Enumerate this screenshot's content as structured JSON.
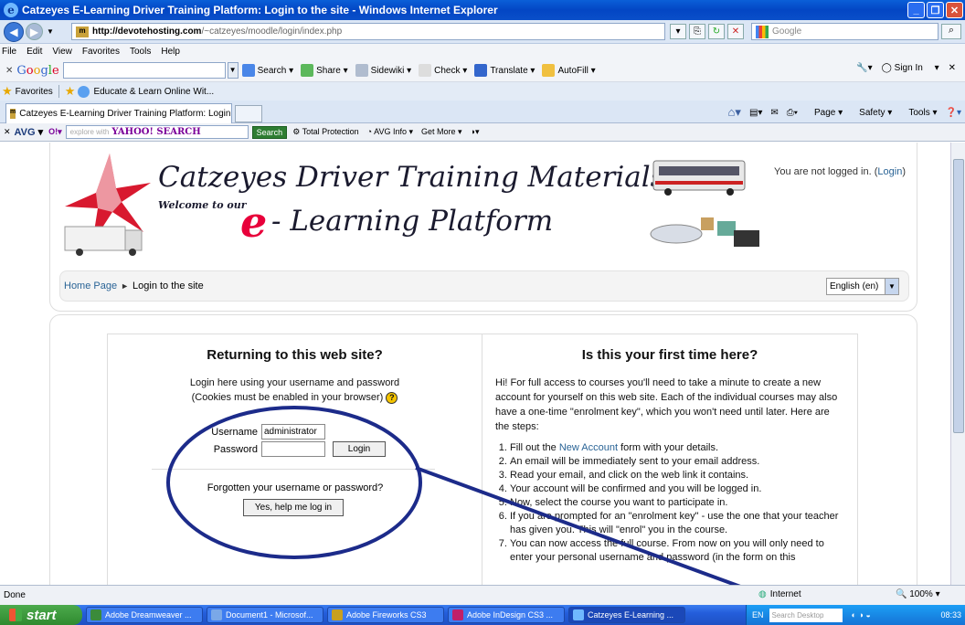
{
  "window": {
    "title": "Catzeyes E-Learning Driver Training Platform: Login to the site - Windows Internet Explorer",
    "min_label": "_",
    "max_label": "❐",
    "close_label": "✕"
  },
  "address": {
    "favicon": "m",
    "domain": "http://devotehosting.com",
    "path": "/~catzeyes/moodle/login/index.php",
    "search_placeholder": "Google"
  },
  "menu": [
    "File",
    "Edit",
    "View",
    "Favorites",
    "Tools",
    "Help"
  ],
  "google_toolbar": {
    "label": "Google",
    "items": [
      "Search",
      "Share",
      "Sidewiki",
      "Check",
      "Translate",
      "AutoFill"
    ],
    "sign_in": "Sign In"
  },
  "favorites": {
    "label": "Favorites",
    "link": "Educate & Learn Online Wit..."
  },
  "tabs": {
    "active": "Catzeyes E-Learning Driver Training Platform: Login t...",
    "commands": [
      "Page",
      "Safety",
      "Tools"
    ]
  },
  "avg_toolbar": {
    "logo": "AVG",
    "placeholder": "explore with",
    "yahoo": "YAHOO! SEARCH",
    "search_btn": "Search",
    "items": [
      "Total Protection",
      "AVG Info",
      "Get More"
    ]
  },
  "page": {
    "banner_line1": "Catzeyes Driver Training Materials",
    "banner_welcome": "Welcome to our",
    "banner_e": "e",
    "banner_line2": "- Learning Platform",
    "login_status": "You are not logged in. (",
    "login_link": "Login",
    "login_status_end": ")",
    "breadcrumb_home": "Home Page",
    "breadcrumb_current": "Login to the site",
    "language": "English (en)"
  },
  "login_panel": {
    "heading": "Returning to this web site?",
    "intro_line1": "Login here using your username and password",
    "intro_line2": "(Cookies must be enabled in your browser)",
    "username_label": "Username",
    "username_value": "administrator",
    "password_label": "Password",
    "password_value": "",
    "login_button": "Login",
    "forgot_text": "Forgotten your username or password?",
    "help_button": "Yes, help me log in"
  },
  "signup_panel": {
    "heading": "Is this your first time here?",
    "intro": "Hi! For full access to courses you'll need to take a minute to create a new account for yourself on this web site. Each of the individual courses may also have a one-time \"enrolment key\", which you won't need until later. Here are the steps:",
    "steps": [
      {
        "pre": "Fill out the ",
        "link": "New Account",
        "post": " form with your details."
      },
      {
        "pre": "An email will be immediately sent to your email address.",
        "link": "",
        "post": ""
      },
      {
        "pre": "Read your email, and click on the web link it contains.",
        "link": "",
        "post": ""
      },
      {
        "pre": "Your account will be confirmed and you will be logged in.",
        "link": "",
        "post": ""
      },
      {
        "pre": "Now, select the course you want to participate in.",
        "link": "",
        "post": ""
      },
      {
        "pre": "If you are prompted for an \"enrolment key\" - use the one that your teacher has given you. This will \"enrol\" you in the course.",
        "link": "",
        "post": ""
      },
      {
        "pre": "You can now access the full course. From now on you will only need to enter your personal username and password (in the form on this",
        "link": "",
        "post": ""
      }
    ]
  },
  "statusbar": {
    "status": "Done",
    "zone": "Internet",
    "zoom": "100%"
  },
  "taskbar": {
    "start": "start",
    "tasks": [
      "Adobe Dreamweaver ...",
      "Document1 - Microsof...",
      "Adobe Fireworks CS3",
      "Adobe InDesign CS3 ...",
      "Catzeyes E-Learning ..."
    ],
    "lang": "EN",
    "desktop_search": "Search Desktop",
    "clock": "08:33"
  },
  "colors": {
    "annotation": "#1c2b8a",
    "link": "#2a6496",
    "accent_red": "#e8003a"
  }
}
